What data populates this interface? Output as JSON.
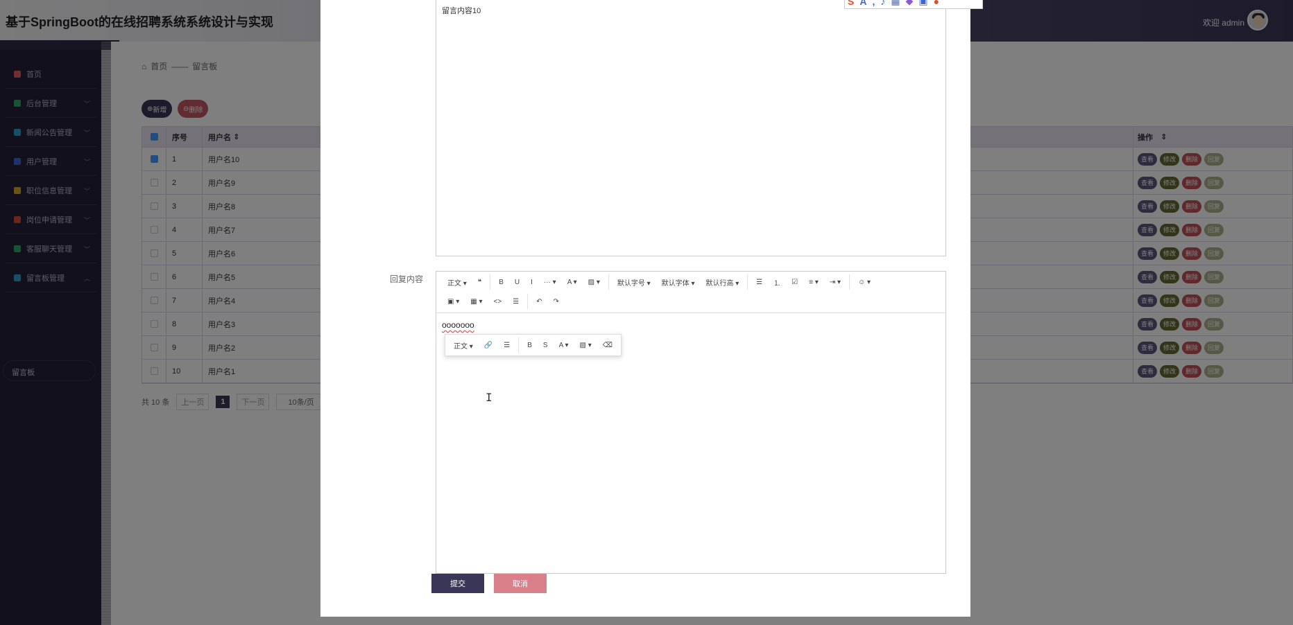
{
  "header": {
    "title": "基于SpringBoot的在线招聘系统系统设计与实现",
    "welcome": "欢迎 admin"
  },
  "sidebar": {
    "items": [
      {
        "label": "首页",
        "color": "#e25f5f"
      },
      {
        "label": "后台管理",
        "color": "#2fa866"
      },
      {
        "label": "新闻公告管理",
        "color": "#2aa0c8"
      },
      {
        "label": "用户管理",
        "color": "#3c68d0"
      },
      {
        "label": "职位信息管理",
        "color": "#d8a32a"
      },
      {
        "label": "岗位申请管理",
        "color": "#d64a3a"
      },
      {
        "label": "客服聊天管理",
        "color": "#2fa866"
      },
      {
        "label": "留言板管理",
        "color": "#2aa0c8"
      }
    ],
    "subitem": "留言板"
  },
  "breadcrumb": {
    "home": "首页",
    "sep": "——",
    "current": "留言板"
  },
  "actions": {
    "add": "新增",
    "delete": "删除"
  },
  "table": {
    "headers": {
      "index": "序号",
      "user": "用户名",
      "ops": "操作"
    },
    "rows": [
      {
        "index": "1",
        "user": "用户名10",
        "checked": true
      },
      {
        "index": "2",
        "user": "用户名9",
        "checked": false
      },
      {
        "index": "3",
        "user": "用户名8",
        "checked": false
      },
      {
        "index": "4",
        "user": "用户名7",
        "checked": false
      },
      {
        "index": "5",
        "user": "用户名6",
        "checked": false
      },
      {
        "index": "6",
        "user": "用户名5",
        "checked": false
      },
      {
        "index": "7",
        "user": "用户名4",
        "checked": false
      },
      {
        "index": "8",
        "user": "用户名3",
        "checked": false
      },
      {
        "index": "9",
        "user": "用户名2",
        "checked": false
      },
      {
        "index": "10",
        "user": "用户名1",
        "checked": false
      }
    ],
    "op_labels": {
      "view": "查看",
      "edit": "修改",
      "delete": "删除",
      "reply": "回复"
    }
  },
  "pager": {
    "total": "共 10 条",
    "prev": "上一页",
    "current": "1",
    "next": "下一页",
    "size": "10条/页"
  },
  "dialog": {
    "message_content": "留言内容10",
    "reply_label": "回复内容",
    "reply_text": "ooooooo",
    "toolbar_row1": [
      "正文 ▾",
      "❝",
      "B",
      "U",
      "I",
      "··· ▾",
      "A ▾",
      "▨ ▾",
      "默认字号 ▾",
      "默认字体 ▾",
      "默认行高 ▾",
      "☰",
      "⒈",
      "☑",
      "≡ ▾",
      "⇥ ▾",
      "☺ ▾"
    ],
    "toolbar_row2": [
      "▣ ▾",
      "▦ ▾",
      "<>",
      "☰",
      "↶",
      "↷"
    ],
    "hover_toolbar": [
      "正文 ▾",
      "🔗",
      "☰",
      "B",
      "S",
      "A ▾",
      "▨ ▾",
      "⌫"
    ],
    "submit": "提交",
    "cancel": "取消"
  },
  "colors": {
    "primary": "#3a3657",
    "danger": "#d9808a",
    "op_view": "#5a567a",
    "op_edit": "#666b36",
    "op_delete": "#c0505a",
    "op_reply": "#aab08a"
  }
}
